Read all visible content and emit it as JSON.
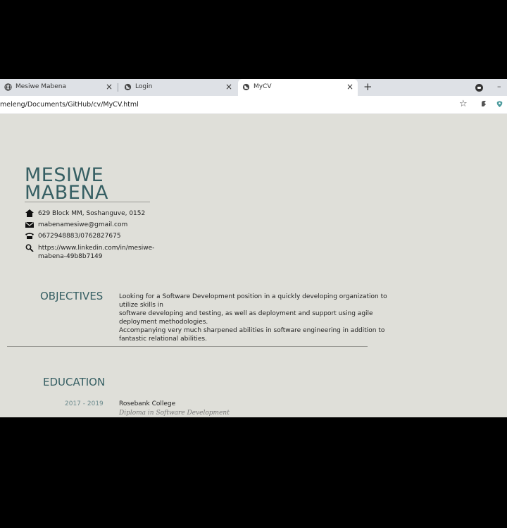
{
  "tabs": [
    {
      "label": "Mesiwe Mabena",
      "icon": "globe-icon"
    },
    {
      "label": "Login",
      "icon": "globe-icon"
    },
    {
      "label": "MyCV",
      "icon": "globe-icon",
      "active": true
    }
  ],
  "tab_close": "×",
  "new_tab": "+",
  "window_min": "–",
  "address": {
    "url": "meleng/Documents/GitHub/cv/MyCV.html"
  },
  "cv": {
    "name_line1": "MESIWE",
    "name_line2": "MABENA",
    "contact": {
      "address": "629 Block MM, Soshanguve, 0152",
      "email": "mabenamesiwe@gmail.com",
      "phone": "0672948883/0762827675",
      "linkedin_line1": "https://www.linkedin.com/in/mesiwe-",
      "linkedin_line2": "mabena-49b8b7149"
    },
    "objectives": {
      "title": "OBJECTIVES",
      "lines": [
        "Looking for a Software Development position in a quickly developing organization to",
        "utilize skills in",
        "software developing and testing, as well as deployment and support using agile",
        "deployment methodologies.",
        "Accompanying very much sharpened abilities in software engineering in addition to",
        "fantastic relational abilities."
      ]
    },
    "education": {
      "title": "EDUCATION",
      "entries": [
        {
          "years": "2017 - 2019",
          "school": "Rosebank College",
          "qualification": "Diploma in Software Development"
        }
      ]
    }
  },
  "colors": {
    "accent": "#365f63",
    "page_bg": "#dfdfd9",
    "tabbar_bg": "#dee1e6"
  }
}
